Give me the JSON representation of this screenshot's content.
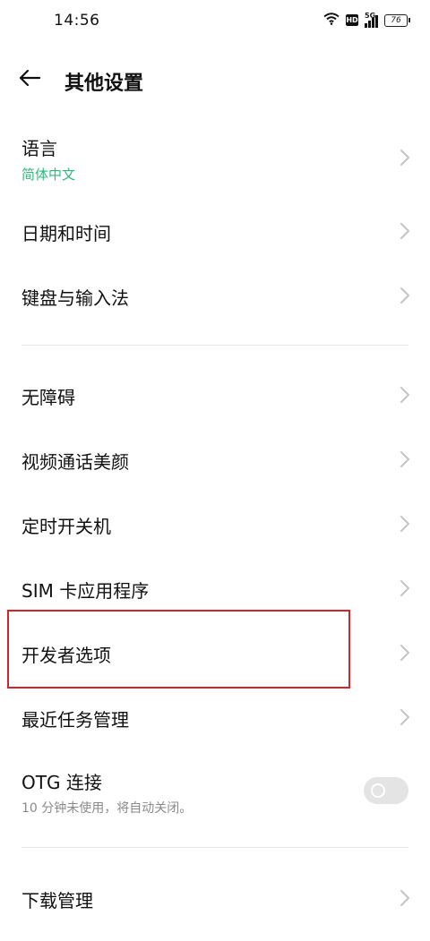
{
  "status_bar": {
    "time": "14:56",
    "hd": "HD",
    "network": "5G",
    "battery": "76"
  },
  "header": {
    "title": "其他设置",
    "back_icon": "arrow-left-icon"
  },
  "settings": {
    "language": {
      "label": "语言",
      "value": "简体中文"
    },
    "datetime": {
      "label": "日期和时间"
    },
    "keyboard": {
      "label": "键盘与输入法"
    },
    "accessibility": {
      "label": "无障碍"
    },
    "video_beauty": {
      "label": "视频通话美颜"
    },
    "scheduled_power": {
      "label": "定时开关机"
    },
    "sim_apps": {
      "label": "SIM 卡应用程序"
    },
    "developer": {
      "label": "开发者选项"
    },
    "recent_tasks": {
      "label": "最近任务管理"
    },
    "otg": {
      "label": "OTG 连接",
      "description": "10 分钟未使用，将自动关闭。",
      "enabled": false
    },
    "downloads": {
      "label": "下载管理"
    }
  },
  "colors": {
    "accent": "#2fb87a",
    "highlight": "#d0252b",
    "chevron": "#c4c4c4"
  }
}
